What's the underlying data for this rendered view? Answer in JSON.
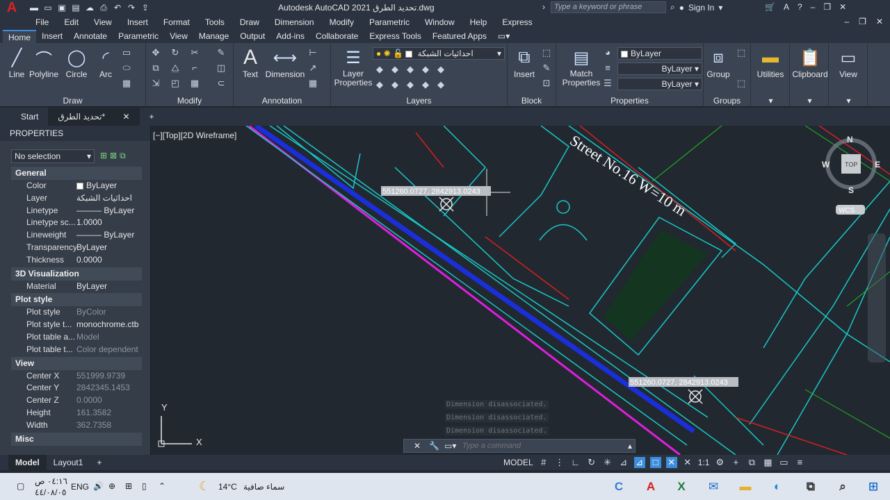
{
  "app": {
    "title": "Autodesk AutoCAD 2021  تحديد الطرق.dwg",
    "logo": "A"
  },
  "search": {
    "placeholder": "Type a keyword or phrase"
  },
  "user": {
    "signin": "Sign In"
  },
  "menu": [
    "File",
    "Edit",
    "View",
    "Insert",
    "Format",
    "Tools",
    "Draw",
    "Dimension",
    "Modify",
    "Parametric",
    "Window",
    "Help",
    "Express"
  ],
  "ribbon_tabs": [
    "Home",
    "Insert",
    "Annotate",
    "Parametric",
    "View",
    "Manage",
    "Output",
    "Add-ins",
    "Collaborate",
    "Express Tools",
    "Featured Apps"
  ],
  "ribbon": {
    "draw": {
      "title": "Draw",
      "line": "Line",
      "polyline": "Polyline",
      "circle": "Circle",
      "arc": "Arc"
    },
    "modify": {
      "title": "Modify"
    },
    "annotation": {
      "title": "Annotation",
      "text": "Text",
      "dimension": "Dimension"
    },
    "layers": {
      "title": "Layers",
      "layer_properties": "Layer\nProperties",
      "current_layer": "احداثيات الشبكة"
    },
    "block": {
      "title": "Block",
      "insert": "Insert"
    },
    "properties": {
      "title": "Properties",
      "match": "Match\nProperties",
      "color": "ByLayer",
      "linetype": "ByLayer",
      "lineweight": "ByLayer"
    },
    "groups": {
      "title": "Groups",
      "group": "Group"
    },
    "utilities": "Utilities",
    "clipboard": "Clipboard",
    "view": "View"
  },
  "file_tabs": {
    "start": "Start",
    "active": "تحديد الطرق*"
  },
  "properties_palette": {
    "title": "PROPERTIES",
    "selection": "No selection",
    "general": {
      "title": "General",
      "color_k": "Color",
      "color_v": "ByLayer",
      "layer_k": "Layer",
      "layer_v": "احداثيات الشبكة",
      "linetype_k": "Linetype",
      "linetype_v": "ByLayer",
      "ltscale_k": "Linetype sc...",
      "ltscale_v": "1.0000",
      "lineweight_k": "Lineweight",
      "lineweight_v": "ByLayer",
      "transparency_k": "Transparency",
      "transparency_v": "ByLayer",
      "thickness_k": "Thickness",
      "thickness_v": "0.0000"
    },
    "viz3d": {
      "title": "3D Visualization",
      "material_k": "Material",
      "material_v": "ByLayer"
    },
    "plot": {
      "title": "Plot style",
      "ps_k": "Plot style",
      "ps_v": "ByColor",
      "pst_k": "Plot style t...",
      "pst_v": "monochrome.ctb",
      "pta_k": "Plot table a...",
      "pta_v": "Model",
      "ptt_k": "Plot table t...",
      "ptt_v": "Color dependent"
    },
    "view": {
      "title": "View",
      "cx_k": "Center X",
      "cx_v": "551999.9739",
      "cy_k": "Center Y",
      "cy_v": "2842345.1453",
      "cz_k": "Center Z",
      "cz_v": "0.0000",
      "h_k": "Height",
      "h_v": "161.3582",
      "w_k": "Width",
      "w_v": "362.7358"
    },
    "misc": {
      "title": "Misc"
    }
  },
  "viewport": {
    "label": "[−][Top][2D Wireframe]",
    "street_text": "Street No.16  W=10 m",
    "coord1": "551260.0727, 2842913.0243",
    "coord2": "551260.0727, 2842913.0243",
    "viewcube": {
      "n": "N",
      "s": "S",
      "e": "E",
      "w": "W",
      "top": "TOP",
      "wcs": "WCS"
    },
    "ucs": {
      "x": "X",
      "y": "Y"
    }
  },
  "command": {
    "history": [
      "Dimension disassociated.",
      "Dimension disassociated.",
      "Dimension disassociated."
    ],
    "placeholder": "Type a command"
  },
  "layout_tabs": [
    "Model",
    "Layout1"
  ],
  "status": {
    "model": "MODEL",
    "scale": "1:1"
  },
  "taskbar": {
    "time": "٠٤:١٦ ص",
    "date": "٤٤/٠٨/٠٥",
    "lang": "ENG",
    "temp": "14°C",
    "weather": "سماء صافية"
  },
  "colors": {
    "accent": "#3c8ddc",
    "cyan": "#19c8c8",
    "blue": "#1a2fd8",
    "magenta": "#e01ee0",
    "red": "#d42020",
    "green": "#20c020"
  }
}
